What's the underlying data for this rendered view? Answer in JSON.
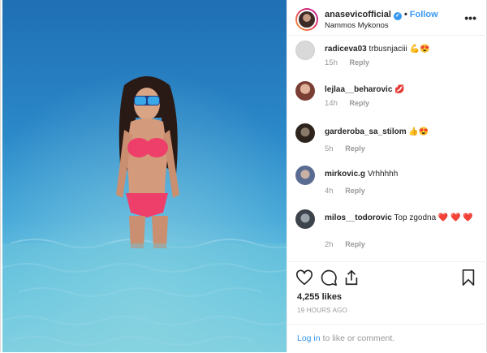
{
  "header": {
    "username": "anasevicofficial",
    "verified_badge": "✓",
    "separator": "•",
    "follow_label": "Follow",
    "location": "Nammos Mykonos",
    "more_icon": "more-horizontal-icon"
  },
  "comments": [
    {
      "user": "radiceva03",
      "text": "trbusnjaciii 💪😍",
      "time": "15h",
      "reply": "Reply",
      "avatar_color": "#d9d9d9"
    },
    {
      "user": "lejlaa__beharovic",
      "text": "💋",
      "time": "14h",
      "reply": "Reply",
      "avatar_color": "#a35b52"
    },
    {
      "user": "garderoba_sa_stilom",
      "text": "👍😍",
      "time": "5h",
      "reply": "Reply",
      "avatar_color": "#4b3b32"
    },
    {
      "user": "mirkovic.g",
      "text": "Vrhhhhh",
      "time": "4h",
      "reply": "Reply",
      "avatar_color": "#7a8fb3"
    },
    {
      "user": "milos__todorovic",
      "text": "Top zgodna ❤️ ❤️ ❤️",
      "time": "2h",
      "reply": "Reply",
      "avatar_color": "#555d66"
    }
  ],
  "actions": {
    "like_icon": "heart-icon",
    "comment_icon": "comment-icon",
    "share_icon": "share-icon",
    "save_icon": "bookmark-icon",
    "likes": "4,255 likes",
    "time_ago": "19 HOURS AGO"
  },
  "login": {
    "link": "Log in",
    "suffix": " to like or comment."
  },
  "colors": {
    "link_blue": "#3897f0",
    "muted": "#999999",
    "text": "#262626",
    "heart_red": "#ed4956"
  }
}
